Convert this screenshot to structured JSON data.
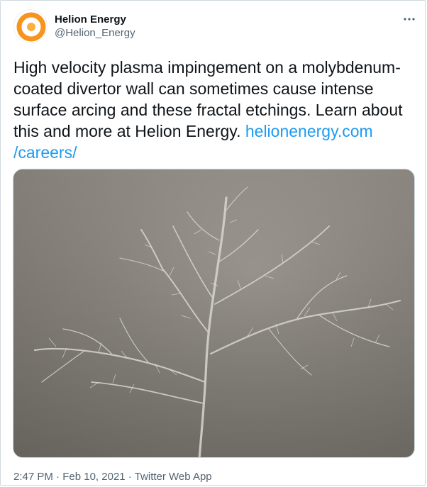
{
  "author": {
    "name": "Helion Energy",
    "handle": "@Helion_Energy",
    "avatar_icon": "helion-logo-icon",
    "brand_colors": [
      "#f7941d",
      "#fbb040"
    ]
  },
  "menu": {
    "more_icon": "more-horizontal-icon"
  },
  "tweet": {
    "text_lines": [
      "High velocity plasma impingement on a molybdenum-",
      "coated divertor wall can sometimes cause intense",
      "surface arcing and these fractal etchings. Learn about",
      "this and more at Helion Energy."
    ],
    "link_part1": "helionenergy.com",
    "link_part2": "/careers/",
    "link_color": "#1d9bf0"
  },
  "media": {
    "icon": "fractal-etching-photo"
  },
  "meta": {
    "time": "2:47 PM",
    "date": "Feb 10, 2021",
    "source": "Twitter Web App",
    "separator": "·"
  }
}
